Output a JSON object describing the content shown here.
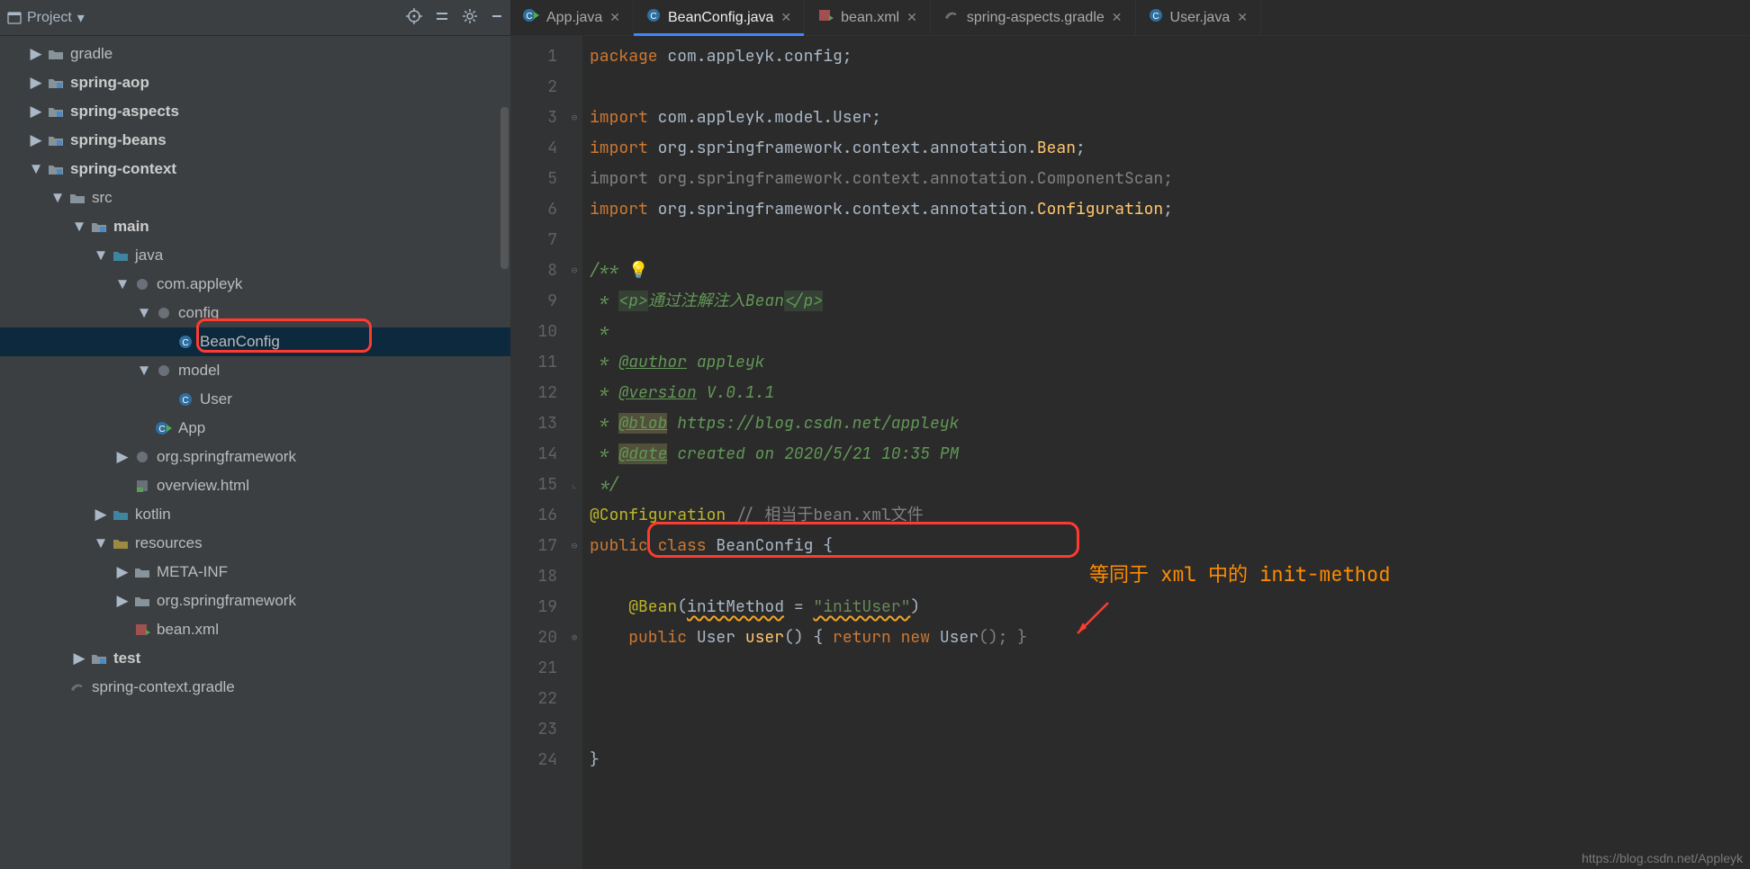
{
  "projectDropdown": "Project",
  "tree": [
    {
      "l": "gradle",
      "d": 1,
      "e": "▶",
      "i": "folder",
      "b": false
    },
    {
      "l": "spring-aop",
      "d": 1,
      "e": "▶",
      "i": "module",
      "b": true
    },
    {
      "l": "spring-aspects",
      "d": 1,
      "e": "▶",
      "i": "module",
      "b": true
    },
    {
      "l": "spring-beans",
      "d": 1,
      "e": "▶",
      "i": "module",
      "b": true
    },
    {
      "l": "spring-context",
      "d": 1,
      "e": "▼",
      "i": "module",
      "b": true
    },
    {
      "l": "src",
      "d": 2,
      "e": "▼",
      "i": "folder",
      "b": false
    },
    {
      "l": "main",
      "d": 3,
      "e": "▼",
      "i": "module",
      "b": true
    },
    {
      "l": "java",
      "d": 4,
      "e": "▼",
      "i": "src-folder",
      "b": false
    },
    {
      "l": "com.appleyk",
      "d": 5,
      "e": "▼",
      "i": "pkg",
      "b": false
    },
    {
      "l": "config",
      "d": 6,
      "e": "▼",
      "i": "pkg",
      "b": false
    },
    {
      "l": "BeanConfig",
      "d": 7,
      "e": "",
      "i": "class",
      "b": false,
      "sel": true
    },
    {
      "l": "model",
      "d": 6,
      "e": "▼",
      "i": "pkg",
      "b": false
    },
    {
      "l": "User",
      "d": 7,
      "e": "",
      "i": "class",
      "b": false
    },
    {
      "l": "App",
      "d": 6,
      "e": "",
      "i": "class-run",
      "b": false
    },
    {
      "l": "org.springframework",
      "d": 5,
      "e": "▶",
      "i": "pkg",
      "b": false
    },
    {
      "l": "overview.html",
      "d": 5,
      "e": "",
      "i": "html",
      "b": false
    },
    {
      "l": "kotlin",
      "d": 4,
      "e": "▶",
      "i": "src-folder",
      "b": false
    },
    {
      "l": "resources",
      "d": 4,
      "e": "▼",
      "i": "res",
      "b": false
    },
    {
      "l": "META-INF",
      "d": 5,
      "e": "▶",
      "i": "folder",
      "b": false
    },
    {
      "l": "org.springframework",
      "d": 5,
      "e": "▶",
      "i": "folder",
      "b": false
    },
    {
      "l": "bean.xml",
      "d": 5,
      "e": "",
      "i": "xml",
      "b": false
    },
    {
      "l": "test",
      "d": 3,
      "e": "▶",
      "i": "module",
      "b": true
    },
    {
      "l": "spring-context.gradle",
      "d": 2,
      "e": "",
      "i": "gradle",
      "b": false
    }
  ],
  "tabs": [
    {
      "label": "App.java",
      "icon": "class-run"
    },
    {
      "label": "BeanConfig.java",
      "icon": "class",
      "active": true
    },
    {
      "label": "bean.xml",
      "icon": "xml"
    },
    {
      "label": "spring-aspects.gradle",
      "icon": "gradle"
    },
    {
      "label": "User.java",
      "icon": "class"
    }
  ],
  "code": {
    "pkg_kw": "package",
    "pkg": " com.appleyk.config;",
    "imp_kw": "import",
    "imp1": " com.appleyk.model.User;",
    "imp2_a": " org.springframework.context.annotation.",
    "imp2_b": "Bean",
    "imp2_c": ";",
    "imp3": " org.springframework.context.annotation.ComponentScan;",
    "imp4_a": " org.springframework.context.annotation.",
    "imp4_b": "Configuration",
    "imp4_c": ";",
    "doc_open": "/**",
    "doc_p1": " * ",
    "doc_p_open": "<p>",
    "doc_p_txt": "通过注解注入Bean",
    "doc_p_close": "</p>",
    "doc_star": " *",
    "doc_author_tag": "@author",
    "doc_author": " appleyk",
    "doc_version_tag": "@version",
    "doc_version": " V.0.1.1",
    "doc_blob_tag": "@blob",
    "doc_blob": " https://blog.csdn.net/appleyk",
    "doc_date_tag": "@date",
    "doc_date": " created on 2020/5/21 10:35 PM",
    "doc_close": " */",
    "ann_conf": "@Configuration",
    "ann_conf_cmt": " // 相当于bean.xml文件",
    "public_kw": "public",
    "class_kw": " class ",
    "class_name": "BeanConfig",
    "brace_open": " {",
    "ann_bean": "@Bean",
    "bean_args_open": "(",
    "bean_param": "initMethod",
    "bean_eq": " = ",
    "bean_val": "\"initUser\"",
    "bean_args_close": ")",
    "method_line_a": "public ",
    "method_line_b": "User ",
    "method_name": "user",
    "method_line_c": "() { ",
    "return_kw": "return ",
    "new_kw": "new ",
    "user_ctor": "User",
    "method_line_d": "(); }",
    "brace_close": "}"
  },
  "lineCount": 24,
  "callout": "等同于 xml 中的 init-method",
  "watermark": "https://blog.csdn.net/Appleyk"
}
